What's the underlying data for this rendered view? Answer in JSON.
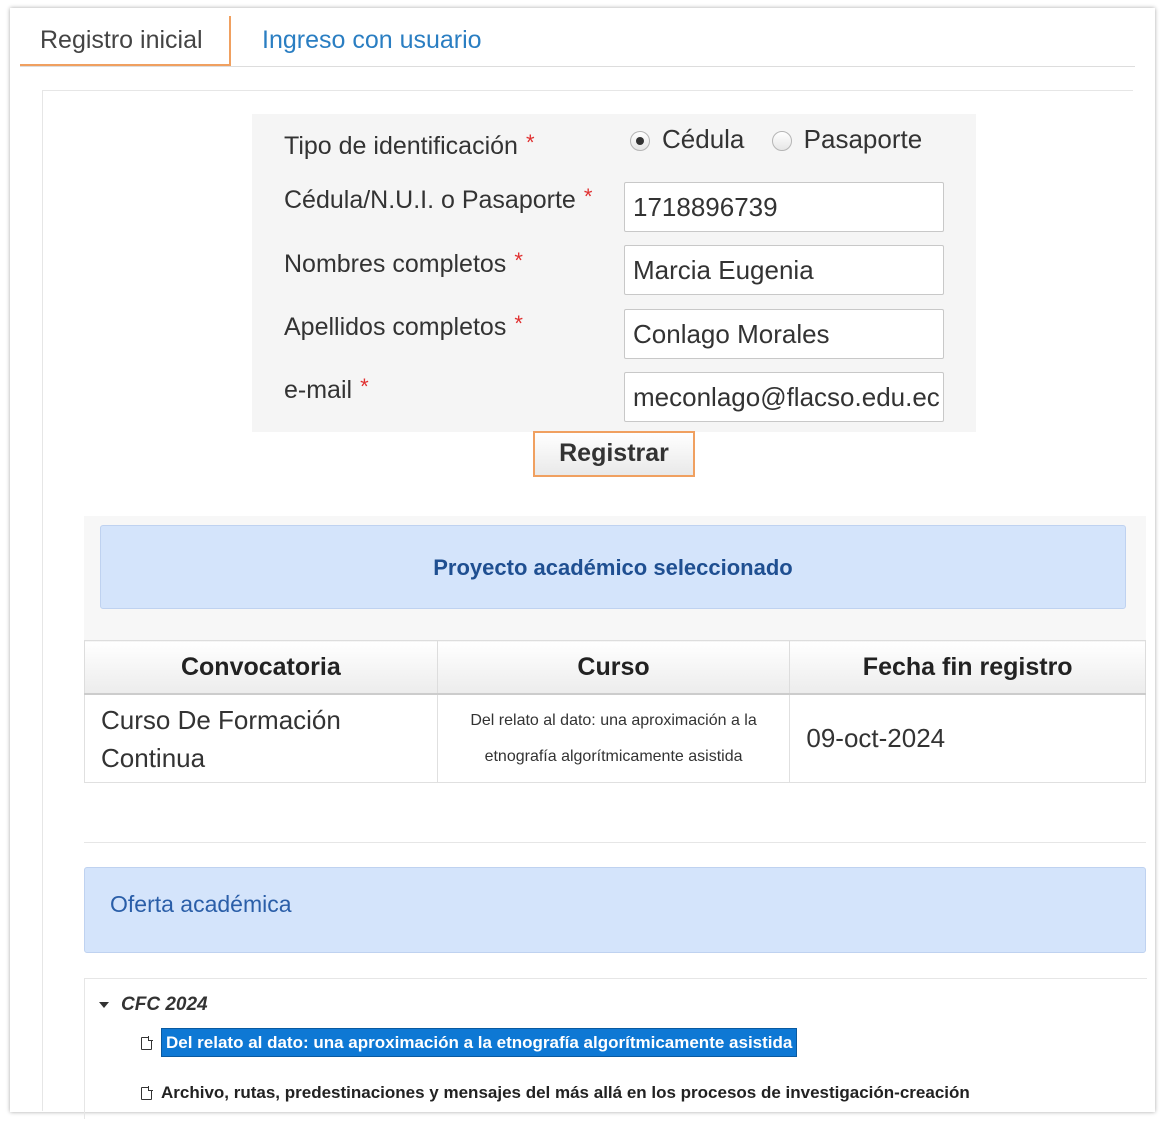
{
  "tabs": {
    "registro": "Registro inicial",
    "ingreso": "Ingreso con usuario"
  },
  "form": {
    "tipo_label": "Tipo de identificación",
    "required_mark": "*",
    "radio_cedula": "Cédula",
    "radio_pasaporte": "Pasaporte",
    "selected_radio": "Cédula",
    "cedula_label": "Cédula/N.U.I. o Pasaporte",
    "cedula_value": "1718896739",
    "nombres_label": "Nombres completos",
    "nombres_value": "Marcia Eugenia",
    "apellidos_label": "Apellidos completos",
    "apellidos_value": "Conlago Morales",
    "email_label": "e-mail",
    "email_value": "meconlago@flacso.edu.ec",
    "submit": "Registrar"
  },
  "proyecto": {
    "header": "Proyecto académico seleccionado",
    "columns": [
      "Convocatoria",
      "Curso",
      "Fecha fin registro"
    ],
    "row": {
      "convocatoria": "Curso De Formación Continua",
      "curso": "Del relato al dato: una aproximación a la etnografía algorítmicamente asistida",
      "fecha": "09-oct-2024"
    }
  },
  "oferta": {
    "header": "Oferta académica",
    "group": "CFC 2024",
    "items": [
      "Del relato al dato: una aproximación a la etnografía algorítmicamente asistida",
      "Archivo, rutas, predestinaciones y mensajes del más allá en los procesos de investigación-creación"
    ]
  },
  "colors": {
    "accent_tab": "#f0a060",
    "link_blue": "#2a7ec2",
    "panel_blue": "#d4e4fb",
    "selected_blue": "#0e78d4"
  }
}
